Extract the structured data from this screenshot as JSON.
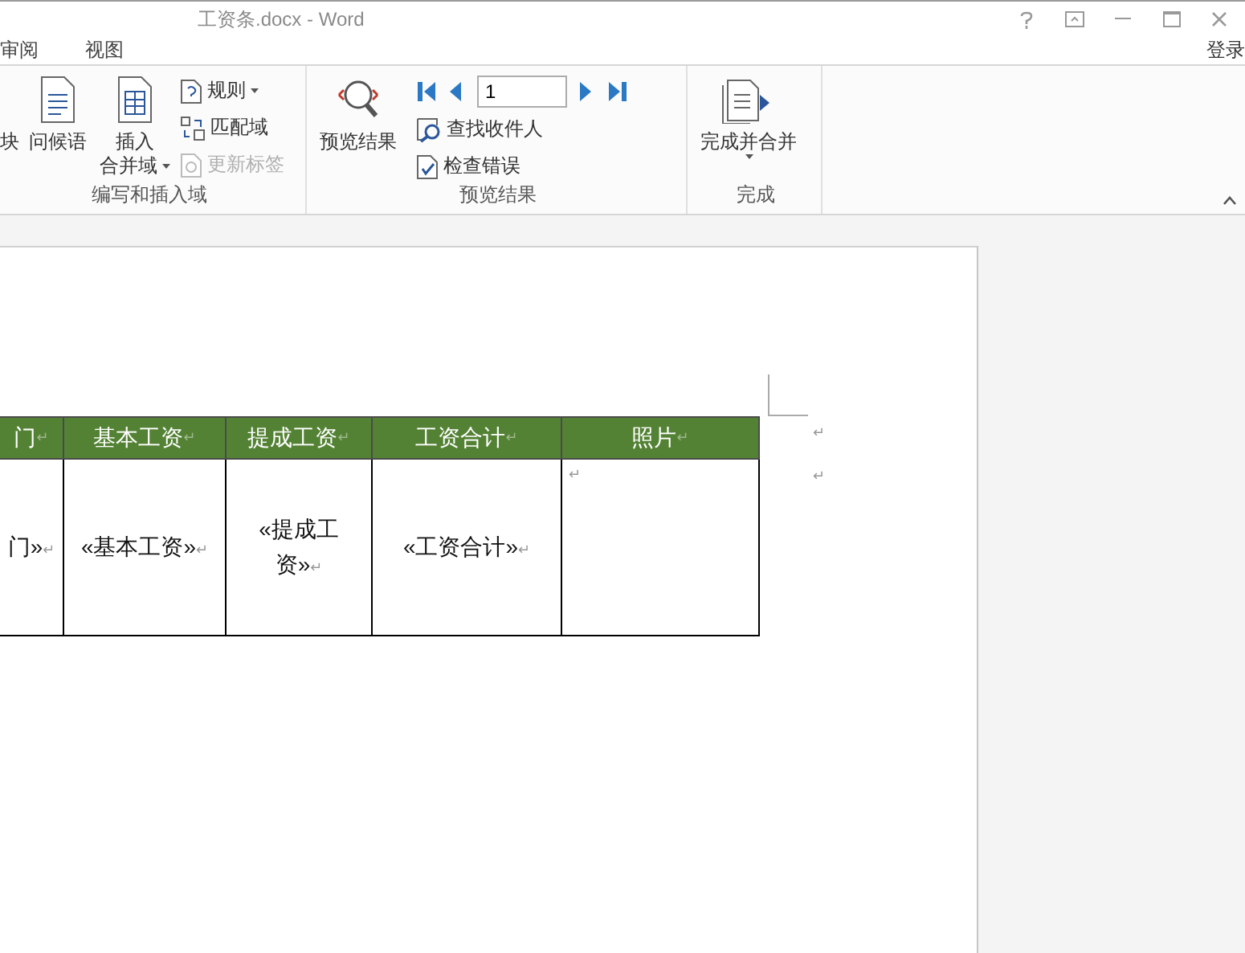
{
  "window": {
    "title": "工资条.docx - Word"
  },
  "tabs": [
    {
      "label": "审阅",
      "selected": false
    },
    {
      "label": "视图",
      "selected": false
    }
  ],
  "account": "登录",
  "ribbon": {
    "groups": [
      {
        "label": "编写和插入域",
        "large": [
          {
            "kind": "cut",
            "lines": [
              "块"
            ],
            "dropdown": false
          },
          {
            "kind": "doc",
            "lines": [
              "问候语"
            ],
            "dropdown": false
          },
          {
            "kind": "grid",
            "lines": [
              "插入",
              "合并域"
            ],
            "dropdown": true
          }
        ],
        "small": [
          {
            "kind": "rule",
            "label": "规则",
            "dropdown": true,
            "disabled": false
          },
          {
            "kind": "match",
            "label": "匹配域",
            "dropdown": false,
            "disabled": false
          },
          {
            "kind": "update",
            "label": "更新标签",
            "dropdown": false,
            "disabled": true
          }
        ]
      },
      {
        "label": "预览结果",
        "large": [
          {
            "kind": "preview",
            "lines": [
              "预览结果"
            ],
            "dropdown": false
          }
        ],
        "record": "1",
        "small": [
          {
            "kind": "find",
            "label": "查找收件人",
            "dropdown": false,
            "disabled": false
          },
          {
            "kind": "check",
            "label": "检查错误",
            "dropdown": false,
            "disabled": false
          }
        ]
      },
      {
        "label": "完成",
        "large": [
          {
            "kind": "finish",
            "lines": [
              "完成并合并"
            ],
            "dropdown": true
          }
        ]
      }
    ]
  },
  "table": {
    "columns": [
      {
        "label": "门",
        "mark": "↵"
      },
      {
        "label": "基本工资",
        "mark": "↵"
      },
      {
        "label": "提成工资",
        "mark": "↵"
      },
      {
        "label": "工资合计",
        "mark": "↵"
      },
      {
        "label": "照片",
        "mark": "↵"
      }
    ],
    "rows": [
      {
        "cells": [
          {
            "text": "门»",
            "mark": "↵"
          },
          {
            "text": "«基本工资»",
            "mark": "↵"
          },
          {
            "text": "«提成工资»",
            "mark": "↵"
          },
          {
            "text": "«工资合计»",
            "mark": "↵"
          },
          {
            "text": "",
            "mark": "↵"
          }
        ]
      }
    ],
    "row_marks": [
      "↵",
      "↵"
    ]
  }
}
